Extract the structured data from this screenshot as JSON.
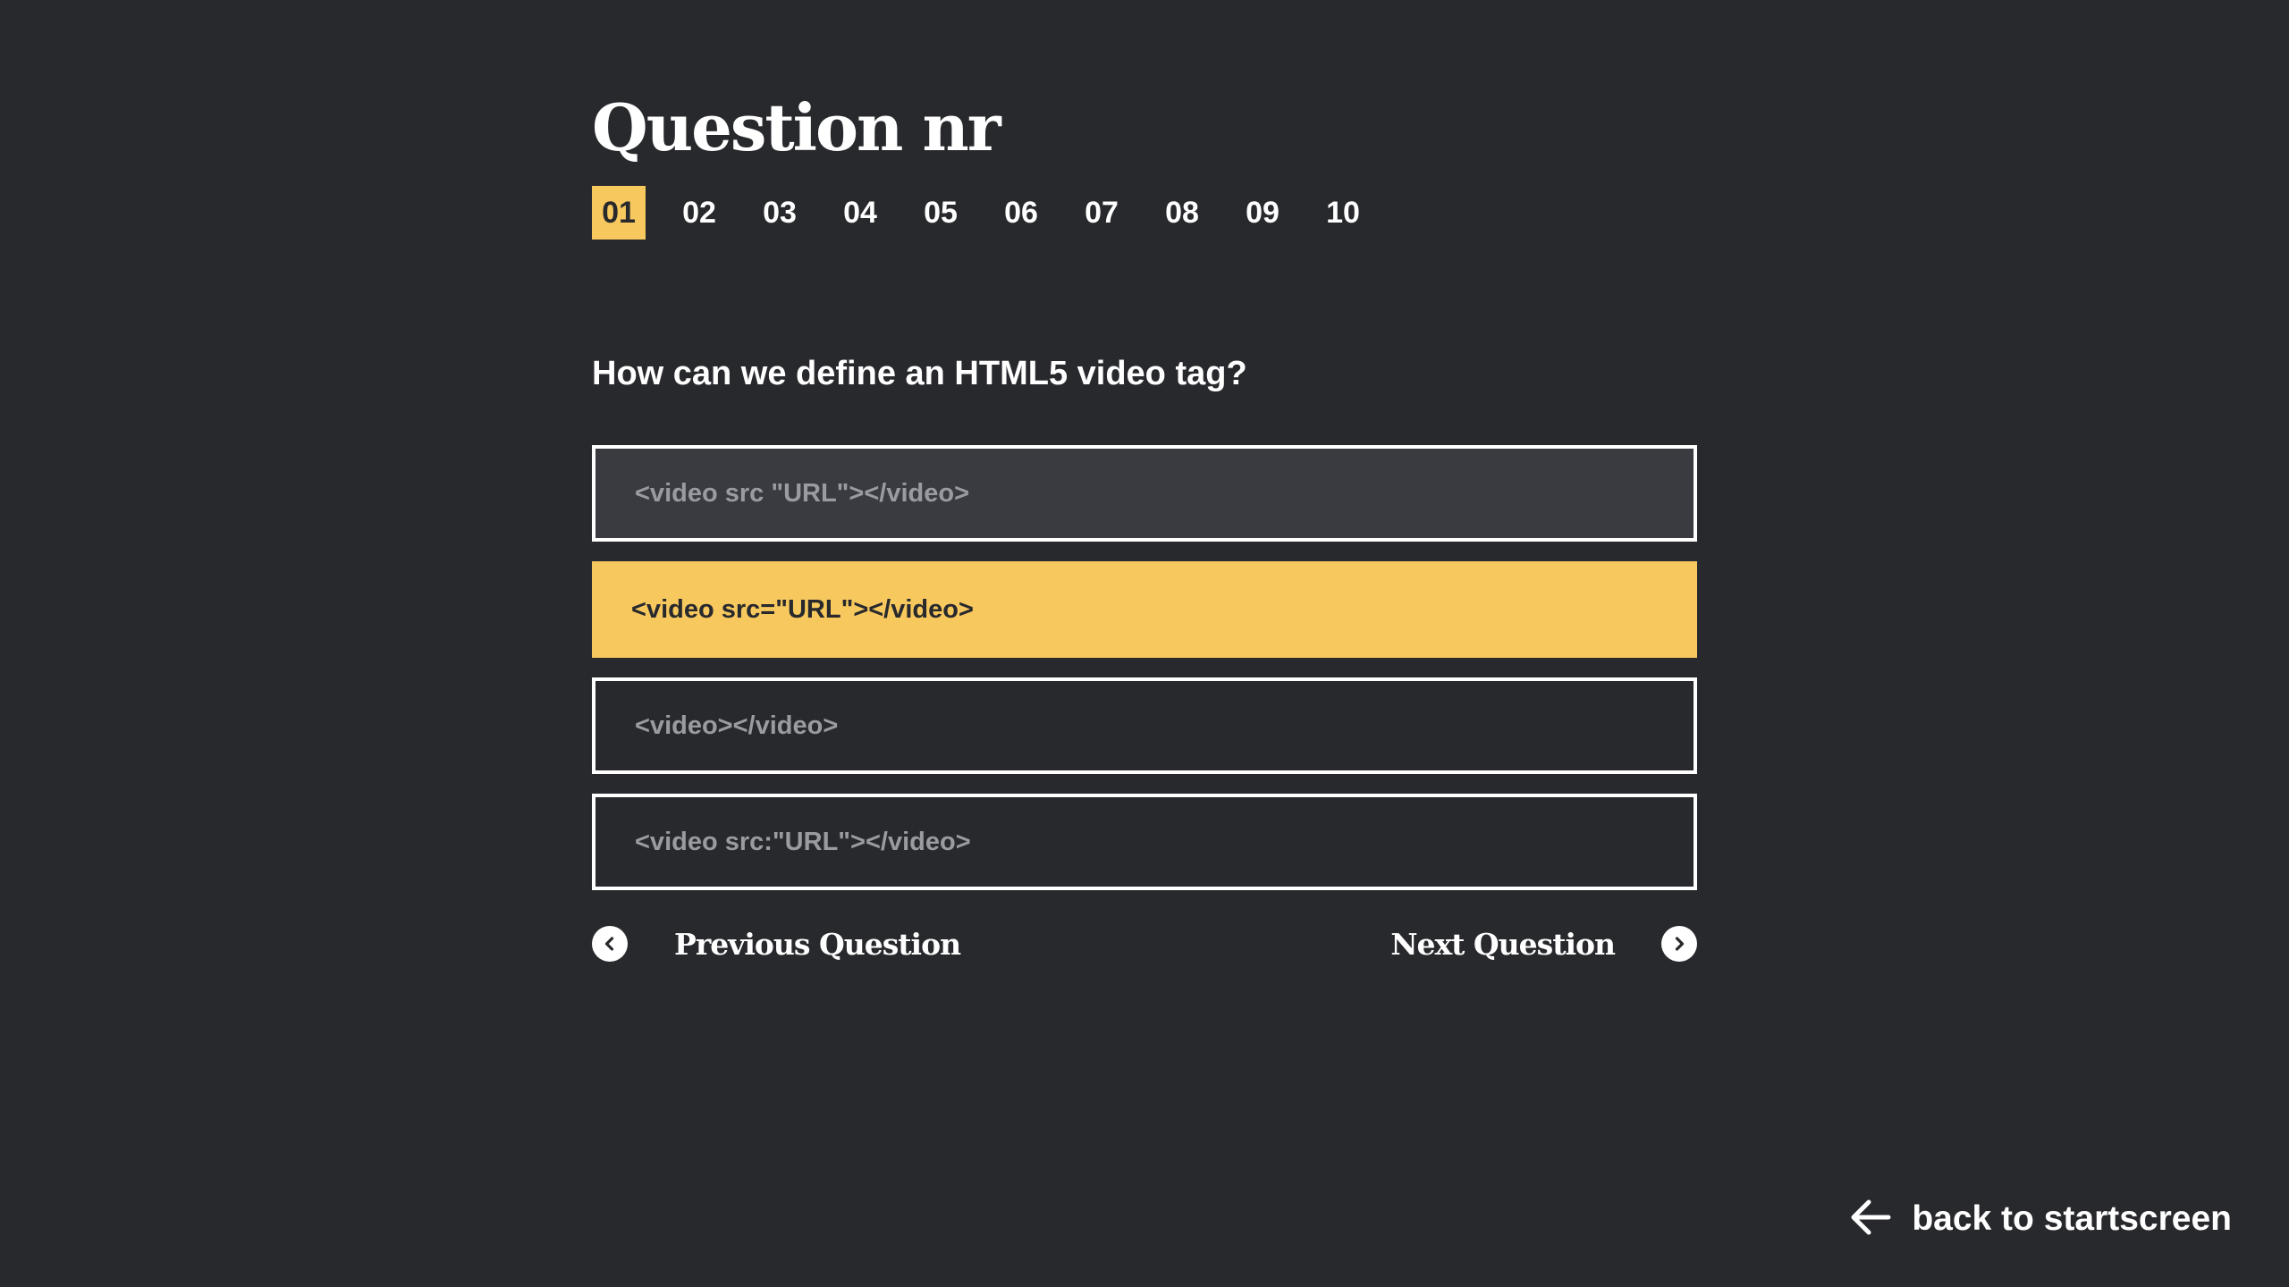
{
  "title": "Question nr",
  "question_nav": {
    "numbers": [
      "01",
      "02",
      "03",
      "04",
      "05",
      "06",
      "07",
      "08",
      "09",
      "10"
    ],
    "active_index": 0
  },
  "question": {
    "text": "How can we define an HTML5 video tag?",
    "answers": [
      {
        "label": "<video src \"URL\"></video>",
        "state": "hover"
      },
      {
        "label": "<video src=\"URL\"></video>",
        "state": "selected"
      },
      {
        "label": "<video></video>",
        "state": "default"
      },
      {
        "label": "<video src:\"URL\"></video>",
        "state": "default"
      }
    ]
  },
  "navigation": {
    "prev_label": "Previous Question",
    "next_label": "Next Question",
    "prev_icon": "chevron-left-circle-icon",
    "next_icon": "chevron-right-circle-icon"
  },
  "back": {
    "label": "back to startscreen",
    "icon": "arrow-left-icon"
  },
  "colors": {
    "background": "#28292d",
    "accent": "#f7c85e",
    "text": "#ffffff",
    "answer_text": "#9a9ba0",
    "answer_hover_bg": "#3a3b41"
  }
}
